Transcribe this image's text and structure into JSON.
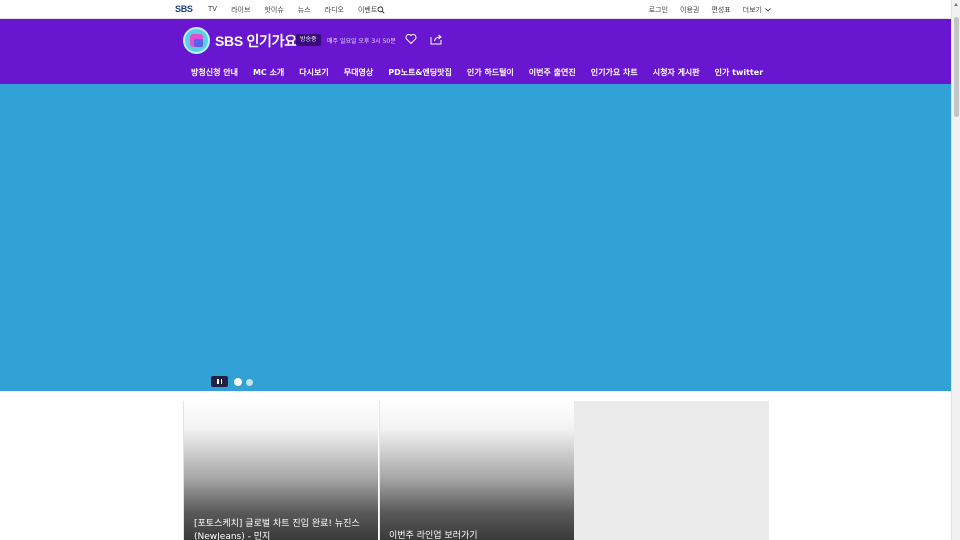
{
  "topbar": {
    "logo": "SBS",
    "nav": [
      "TV",
      "라이브",
      "핫이슈",
      "뉴스",
      "라디오",
      "이벤트"
    ],
    "util": [
      "로그인",
      "이용권",
      "편성표",
      "더보기"
    ]
  },
  "header": {
    "title": "SBS 인기가요",
    "badge": "방송중",
    "schedule": "매주 일요일 오후 3시 50분",
    "menu": [
      "방청신청 안내",
      "MC 소개",
      "다시보기",
      "무대영상",
      "PD노트&엔딩맛집",
      "인가 하드털이",
      "이번주 출연진",
      "인기가요 차트",
      "시청자 게시판",
      "인가 twitter"
    ]
  },
  "hero": {
    "bg_color": "#31a1d6",
    "slides_total": 2,
    "active_slide": 1
  },
  "cards": [
    {
      "text": "[포토스케치] 글로벌 차트 진입 완료! 뉴진스(NewJeans) - 민지"
    },
    {
      "text": "이번주 라인업 보러가기"
    },
    {
      "text": ""
    }
  ],
  "colors": {
    "brand_purple": "#6816cf",
    "sbs_blue": "#1b3f8e"
  },
  "icons": [
    "search-icon",
    "chevron-down-icon",
    "heart-icon",
    "share-icon",
    "pause-icon"
  ]
}
